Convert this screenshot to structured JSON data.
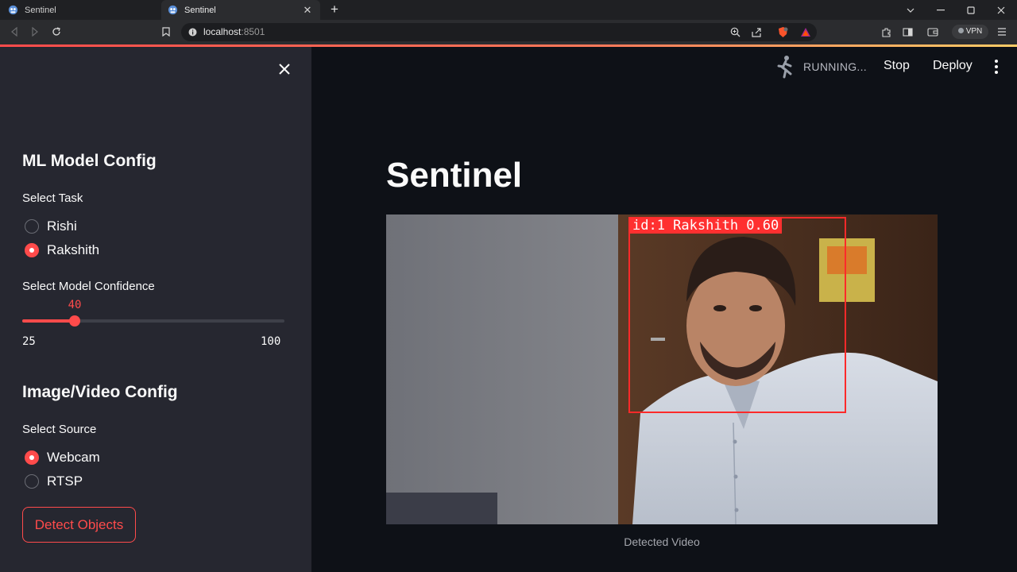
{
  "browser": {
    "tabs": [
      {
        "title": "Sentinel",
        "active": false
      },
      {
        "title": "Sentinel",
        "active": true
      }
    ],
    "url_host": "localhost",
    "url_port": ":8501",
    "vpn_label": "VPN"
  },
  "header": {
    "status_text": "RUNNING...",
    "stop_label": "Stop",
    "deploy_label": "Deploy"
  },
  "sidebar": {
    "model_heading": "ML Model Config",
    "task_label": "Select Task",
    "task_options": [
      {
        "label": "Rishi",
        "selected": false
      },
      {
        "label": "Rakshith",
        "selected": true
      }
    ],
    "confidence_label": "Select Model Confidence",
    "confidence": {
      "value": "40",
      "min": "25",
      "max": "100"
    },
    "source_heading": "Image/Video Config",
    "source_label": "Select Source",
    "source_options": [
      {
        "label": "Webcam",
        "selected": true
      },
      {
        "label": "RTSP",
        "selected": false
      }
    ],
    "detect_button": "Detect Objects"
  },
  "main": {
    "title": "Sentinel",
    "detection_label": "id:1 Rakshith 0.60",
    "caption": "Detected Video"
  },
  "colors": {
    "accent": "#ff4b4b",
    "sidebar_bg": "#262730",
    "main_bg": "#0e1117"
  }
}
